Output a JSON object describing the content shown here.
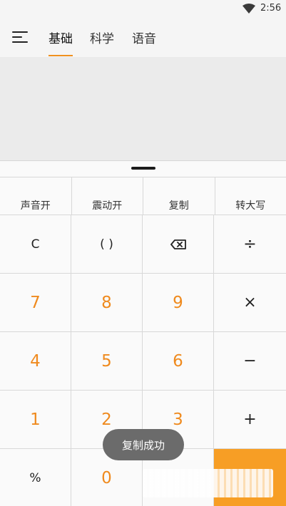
{
  "status_bar": {
    "time": "2:56",
    "wifi_icon": "wifi-icon"
  },
  "tabs": [
    {
      "label": "基础",
      "active": true
    },
    {
      "label": "科学",
      "active": false
    },
    {
      "label": "语音",
      "active": false
    }
  ],
  "function_row": [
    "声音开",
    "震动开",
    "复制",
    "转大写"
  ],
  "keys": {
    "clear": "C",
    "parentheses": "( )",
    "backspace_icon": "backspace-icon",
    "divide": "÷",
    "seven": "7",
    "eight": "8",
    "nine": "9",
    "multiply": "×",
    "four": "4",
    "five": "5",
    "six": "6",
    "minus": "−",
    "one": "1",
    "two": "2",
    "three": "3",
    "plus": "+",
    "percent": "%",
    "zero": "0"
  },
  "toast": "复制成功",
  "colors": {
    "accent": "#ef8a1e",
    "equals_bg": "#f79e25"
  }
}
